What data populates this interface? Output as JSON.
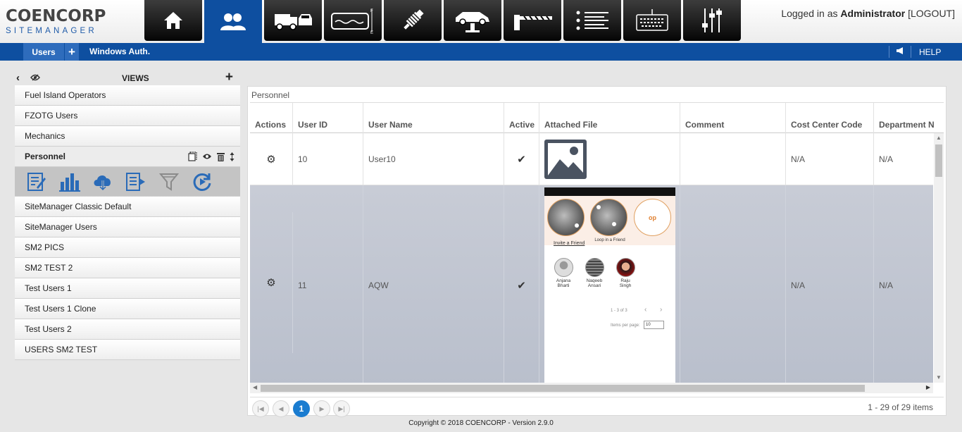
{
  "brand": {
    "name": "COENCORP",
    "sub": "SITEMANAGER"
  },
  "modules": [
    {
      "icon": "home-icon"
    },
    {
      "icon": "users-icon"
    },
    {
      "icon": "vehicles-icon"
    },
    {
      "icon": "fuel-tank-icon"
    },
    {
      "icon": "parts-icon"
    },
    {
      "icon": "vehicle-lift-icon"
    },
    {
      "icon": "barrier-gate-icon"
    },
    {
      "icon": "list-icon"
    },
    {
      "icon": "terminal-icon"
    },
    {
      "icon": "settings-sliders-icon"
    }
  ],
  "login": {
    "prefix": "Logged in as",
    "user": "Administrator",
    "logout": "[LOGOUT]"
  },
  "nav": {
    "tab": "Users",
    "plus": "+",
    "link": "Windows Auth.",
    "help": "HELP"
  },
  "views": {
    "title": "VIEWS",
    "items_before": [
      "Fuel Island Operators",
      "FZOTG Users",
      "Mechanics"
    ],
    "selected": "Personnel",
    "items_after": [
      "SiteManager Classic Default",
      "SiteManager Users",
      "SM2 PICS",
      "SM2 TEST 2",
      "Test Users 1",
      "Test Users 1 Clone",
      "Test Users 2",
      "USERS SM2 TEST"
    ]
  },
  "grid": {
    "title": "Personnel",
    "columns": [
      "Actions",
      "User ID",
      "User Name",
      "Active",
      "Attached File",
      "Comment",
      "Cost Center Code",
      "Department N"
    ],
    "rows": [
      {
        "user_id": "10",
        "user_name": "User10",
        "active": "✔",
        "comment": "",
        "cost_center": "N/A",
        "department": "N/A"
      },
      {
        "user_id": "11",
        "user_name": "AQW",
        "active": "✔",
        "comment": "",
        "cost_center": "N/A",
        "department": "N/A"
      }
    ],
    "pager": {
      "current_page": "1",
      "info": "1 - 29 of 29 items"
    }
  },
  "attachment": {
    "loop_text": "Loop in a Friend",
    "invite": "Invite a Friend",
    "op": "op",
    "friends": [
      {
        "first": "Anjana",
        "last": "Bharti"
      },
      {
        "first": "Naqeeb",
        "last": "Ansari"
      },
      {
        "first": "Raju",
        "last": "Singh"
      }
    ],
    "count": "1 - 3 of 3",
    "ipp_label": "Items per page:",
    "ipp_value": "10"
  },
  "footer": "Copyright © 2018 COENCORP - Version 2.9.0"
}
